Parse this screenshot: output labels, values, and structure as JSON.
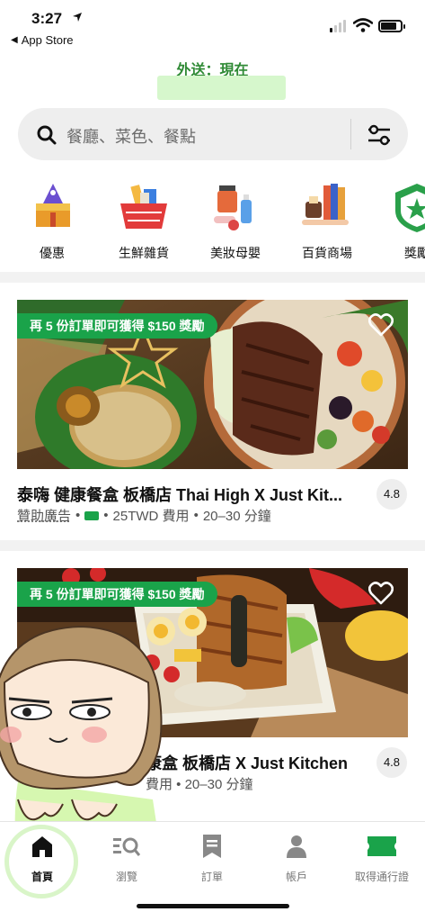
{
  "status_bar": {
    "time": "3:27",
    "back_app": "App Store"
  },
  "header": {
    "delivery_label": "外送：現在"
  },
  "search": {
    "placeholder": "餐廳、菜色、餐點"
  },
  "categories": [
    {
      "label": "優惠",
      "icon": "deals-tag-icon"
    },
    {
      "label": "生鮮雜貨",
      "icon": "grocery-basket-icon"
    },
    {
      "label": "美妝母嬰",
      "icon": "beauty-baby-icon"
    },
    {
      "label": "百貨商場",
      "icon": "department-store-icon"
    },
    {
      "label": "獎勵",
      "icon": "reward-badge-icon"
    }
  ],
  "stores": [
    {
      "promo": "再 5 份訂單即可獲得 $150 獎勵",
      "title": "泰嗨 健康餐盒 板橋店 Thai High X Just Kit...",
      "sponsored": "贊助廣告",
      "fee": "25TWD 費用",
      "eta": "20–30 分鐘",
      "rating": "4.8"
    },
    {
      "promo": "再 5 份訂單即可獲得 $150 獎勵",
      "title": "康盒 板橋店 X Just Kitchen",
      "meta": "費用 • 20–30 分鐘",
      "rating": "4.8"
    }
  ],
  "bottom_nav": [
    {
      "label": "首頁",
      "icon": "home-icon",
      "active": true
    },
    {
      "label": "瀏覽",
      "icon": "browse-icon"
    },
    {
      "label": "訂單",
      "icon": "orders-icon"
    },
    {
      "label": "帳戶",
      "icon": "account-icon"
    },
    {
      "label": "取得通行證",
      "icon": "pass-ticket-icon"
    }
  ],
  "colors": {
    "accent": "#1aa34a",
    "header_green": "#2f8a35",
    "address_highlight": "#d6f7cc"
  }
}
